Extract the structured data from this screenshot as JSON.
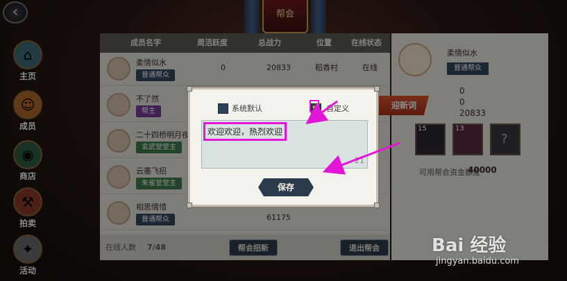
{
  "nav": {
    "items": [
      {
        "label": "主页",
        "icon": "home-icon"
      },
      {
        "label": "成员",
        "icon": "member-icon"
      },
      {
        "label": "商店",
        "icon": "shop-icon"
      },
      {
        "label": "拍卖",
        "icon": "auction-icon"
      },
      {
        "label": "活动",
        "icon": "event-icon"
      }
    ]
  },
  "banner": {
    "text": "帮会"
  },
  "table": {
    "headers": [
      "成员名字",
      "周活跃度",
      "总战力",
      "位置",
      "在线状态"
    ],
    "rows": [
      {
        "name": "柔情似水",
        "role": "普通帮众",
        "activity": "0",
        "power": "20833",
        "location": "稻香村",
        "status": "在线"
      },
      {
        "name": "不了然",
        "role": "帮主",
        "activity": "",
        "power": "",
        "location": "",
        "status": ""
      },
      {
        "name": "二十四桥明月夜",
        "role": "玄武堂堂主",
        "activity": "",
        "power": "",
        "location": "",
        "status": ""
      },
      {
        "name": "云墨飞招",
        "role": "朱雀堂堂主",
        "activity": "",
        "power": "",
        "location": "",
        "status": ""
      },
      {
        "name": "相思情惜",
        "role": "普通帮众",
        "activity": "",
        "power": "61175",
        "location": "",
        "status": ""
      }
    ]
  },
  "footer": {
    "online_label": "在线人数",
    "online_count": "7/48",
    "recruit_button": "帮会招新",
    "leave_button": "退出帮会"
  },
  "info": {
    "name": "柔情似水",
    "role": "普通帮众",
    "stat_1": "0",
    "stat_2": "0",
    "stat_3": "20833",
    "card_1": "15",
    "card_2": "13",
    "card_3": "?",
    "fund_label": "可用帮会资金额度",
    "fund_value": "40000",
    "greeting_tab": "迎新词"
  },
  "dialog": {
    "option_default": "系统默认",
    "option_custom": "自定义",
    "custom_checked": true,
    "message": "欢迎欢迎，热烈欢迎",
    "char_count": "21",
    "save_button": "保存"
  },
  "colors": {
    "annotation": "#e316d8",
    "accent": "#2a3b4e"
  },
  "watermark": {
    "main": "Bai 经验",
    "sub": "jingyan.baidu.com"
  }
}
